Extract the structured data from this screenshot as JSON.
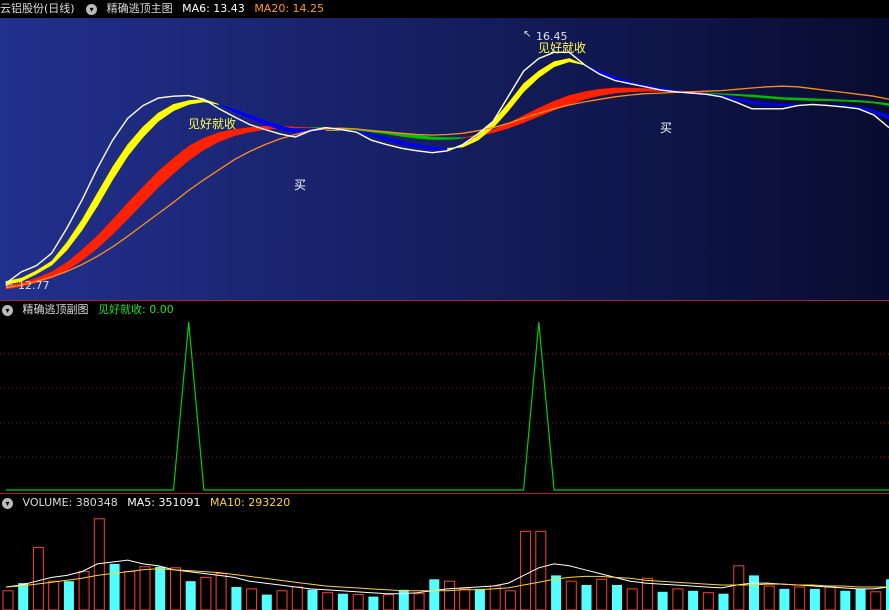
{
  "main": {
    "stock_name": "云铝股份(日线)",
    "indicator_name": "精确逃顶主图",
    "ma6_label": "MA6: 13.43",
    "ma20_label": "MA20: 14.25",
    "annotations": {
      "high_label": "16.45",
      "low_label": "12.77",
      "sell_1": "见好就收",
      "sell_2": "见好就收",
      "buy_1": "买",
      "buy_2": "买"
    },
    "colors": {
      "bg_top": "#1e2a86",
      "bg_bottom": "#0a0f3a",
      "price": "#ffffff",
      "ma": "#ff8c1a",
      "fast_band_up": "#ffff00",
      "fast_band_down": "#0000ff",
      "slow_band_up": "#ff2200",
      "slow_band_down": "#00c000"
    }
  },
  "sub": {
    "indicator_name": "精确逃顶副图",
    "signal_label": "见好就收: 0.00",
    "color": "#00d000"
  },
  "volume": {
    "volume_label": "VOLUME: 380348",
    "ma5_label": "MA5: 351091",
    "ma10_label": "MA10: 293220"
  },
  "chart_data": [
    {
      "type": "line",
      "name": "main",
      "n": 59,
      "price_range": [
        12.6,
        16.9
      ],
      "series": [
        {
          "key": "price",
          "values": [
            12.77,
            12.95,
            13.05,
            13.25,
            13.65,
            14.1,
            14.6,
            15.05,
            15.4,
            15.6,
            15.72,
            15.75,
            15.76,
            15.7,
            15.55,
            15.42,
            15.3,
            15.22,
            15.15,
            15.1,
            15.2,
            15.25,
            15.22,
            15.18,
            15.05,
            14.98,
            14.92,
            14.88,
            14.85,
            14.88,
            14.98,
            15.15,
            15.35,
            15.75,
            16.15,
            16.35,
            16.45,
            16.45,
            16.25,
            16.1,
            16.0,
            15.95,
            15.9,
            15.85,
            15.82,
            15.8,
            15.78,
            15.74,
            15.65,
            15.55,
            15.55,
            15.55,
            15.6,
            15.62,
            15.6,
            15.58,
            15.55,
            15.45,
            15.25
          ]
        },
        {
          "key": "fast",
          "values": [
            12.8,
            12.85,
            12.97,
            13.12,
            13.42,
            13.78,
            14.2,
            14.62,
            14.98,
            15.26,
            15.48,
            15.62,
            15.68,
            15.7,
            15.62,
            15.5,
            15.4,
            15.3,
            15.22,
            15.17,
            15.18,
            15.2,
            15.21,
            15.19,
            15.12,
            15.05,
            14.98,
            14.94,
            14.9,
            14.9,
            14.96,
            15.12,
            15.35,
            15.64,
            15.95,
            16.15,
            16.3,
            16.35,
            16.25,
            16.12,
            16.02,
            15.95,
            15.9,
            15.85,
            15.82,
            15.79,
            15.77,
            15.74,
            15.69,
            15.63,
            15.61,
            15.6,
            15.6,
            15.61,
            15.61,
            15.59,
            15.56,
            15.49,
            15.38
          ]
        },
        {
          "key": "fast2",
          "values": [
            12.75,
            12.8,
            12.92,
            13.06,
            13.3,
            13.62,
            14.0,
            14.42,
            14.8,
            15.1,
            15.35,
            15.52,
            15.62,
            15.66,
            15.62,
            15.54,
            15.45,
            15.36,
            15.28,
            15.22,
            15.2,
            15.2,
            15.21,
            15.2,
            15.15,
            15.09,
            15.03,
            14.98,
            14.94,
            14.92,
            14.94,
            15.05,
            15.25,
            15.52,
            15.82,
            16.05,
            16.22,
            16.3,
            16.25,
            16.15,
            16.06,
            15.98,
            15.93,
            15.88,
            15.84,
            15.81,
            15.79,
            15.76,
            15.72,
            15.67,
            15.64,
            15.62,
            15.61,
            15.61,
            15.61,
            15.6,
            15.58,
            15.53,
            15.44
          ]
        },
        {
          "key": "slow",
          "values": [
            12.72,
            12.78,
            12.85,
            12.95,
            13.1,
            13.3,
            13.52,
            13.78,
            14.05,
            14.3,
            14.55,
            14.76,
            14.95,
            15.08,
            15.17,
            15.22,
            15.25,
            15.27,
            15.27,
            15.26,
            15.25,
            15.24,
            15.23,
            15.21,
            15.18,
            15.15,
            15.11,
            15.08,
            15.06,
            15.06,
            15.08,
            15.14,
            15.22,
            15.32,
            15.44,
            15.56,
            15.67,
            15.76,
            15.82,
            15.86,
            15.88,
            15.88,
            15.87,
            15.86,
            15.84,
            15.82,
            15.8,
            15.78,
            15.76,
            15.74,
            15.72,
            15.7,
            15.69,
            15.68,
            15.68,
            15.67,
            15.66,
            15.64,
            15.6
          ]
        },
        {
          "key": "slow2",
          "values": [
            12.68,
            12.72,
            12.78,
            12.86,
            12.98,
            13.14,
            13.33,
            13.55,
            13.8,
            14.05,
            14.3,
            14.52,
            14.73,
            14.9,
            15.03,
            15.12,
            15.18,
            15.22,
            15.24,
            15.25,
            15.25,
            15.25,
            15.24,
            15.23,
            15.21,
            15.19,
            15.16,
            15.13,
            15.1,
            15.09,
            15.09,
            15.12,
            15.17,
            15.24,
            15.33,
            15.43,
            15.53,
            15.62,
            15.7,
            15.76,
            15.8,
            15.82,
            15.83,
            15.83,
            15.82,
            15.81,
            15.8,
            15.79,
            15.78,
            15.77,
            15.75,
            15.73,
            15.72,
            15.71,
            15.7,
            15.69,
            15.68,
            15.66,
            15.63
          ]
        },
        {
          "key": "ma",
          "values": [
            12.7,
            12.74,
            12.8,
            12.87,
            12.96,
            13.07,
            13.2,
            13.35,
            13.52,
            13.7,
            13.88,
            14.06,
            14.25,
            14.42,
            14.58,
            14.74,
            14.87,
            14.98,
            15.07,
            15.14,
            15.2,
            15.23,
            15.24,
            15.23,
            15.2,
            15.18,
            15.16,
            15.14,
            15.13,
            15.14,
            15.16,
            15.2,
            15.25,
            15.32,
            15.4,
            15.48,
            15.55,
            15.61,
            15.66,
            15.7,
            15.74,
            15.77,
            15.79,
            15.8,
            15.81,
            15.82,
            15.83,
            15.84,
            15.86,
            15.88,
            15.9,
            15.91,
            15.9,
            15.87,
            15.84,
            15.81,
            15.78,
            15.75,
            15.7
          ]
        }
      ]
    },
    {
      "type": "line",
      "name": "signal",
      "values": [
        0,
        0,
        0,
        0,
        0,
        0,
        0,
        0,
        0,
        0,
        0,
        0,
        1,
        0,
        0,
        0,
        0,
        0,
        0,
        0,
        0,
        0,
        0,
        0,
        0,
        0,
        0,
        0,
        0,
        0,
        0,
        0,
        0,
        0,
        0,
        1,
        0,
        0,
        0,
        0,
        0,
        0,
        0,
        0,
        0,
        0,
        0,
        0,
        0,
        0,
        0,
        0,
        0,
        0,
        0,
        0,
        0,
        0,
        0
      ],
      "ylim": [
        0,
        1
      ]
    },
    {
      "type": "bar",
      "name": "volume",
      "values": [
        20,
        28,
        65,
        30,
        30,
        40,
        95,
        48,
        40,
        45,
        45,
        44,
        30,
        34,
        38,
        24,
        22,
        16,
        20,
        24,
        21,
        18,
        17,
        16,
        14,
        16,
        21,
        17,
        32,
        30,
        22,
        22,
        25,
        20,
        82,
        82,
        36,
        30,
        26,
        32,
        26,
        22,
        33,
        19,
        22,
        20,
        18,
        17,
        46,
        36,
        25,
        22,
        24,
        22,
        24,
        20,
        22,
        19,
        32
      ],
      "up": [
        1,
        0,
        1,
        1,
        0,
        1,
        1,
        0,
        1,
        1,
        0,
        1,
        0,
        1,
        1,
        0,
        1,
        0,
        1,
        1,
        0,
        1,
        0,
        1,
        0,
        1,
        0,
        1,
        0,
        1,
        1,
        0,
        1,
        1,
        1,
        1,
        0,
        1,
        0,
        1,
        0,
        1,
        1,
        0,
        1,
        0,
        1,
        0,
        1,
        0,
        1,
        0,
        1,
        0,
        1,
        0,
        0,
        1,
        0
      ],
      "ma5": [
        24,
        26,
        30,
        34,
        36,
        40,
        48,
        50,
        52,
        48,
        46,
        42,
        40,
        38,
        36,
        34,
        30,
        28,
        26,
        24,
        22,
        21,
        20,
        19,
        18,
        17,
        17,
        18,
        20,
        22,
        23,
        24,
        25,
        28,
        36,
        44,
        48,
        46,
        42,
        38,
        34,
        30,
        28,
        27,
        26,
        25,
        24,
        23,
        26,
        28,
        28,
        27,
        26,
        25,
        24,
        23,
        22,
        22,
        24
      ],
      "ma10": [
        24,
        25,
        27,
        29,
        31,
        33,
        36,
        38,
        40,
        42,
        43,
        42,
        41,
        40,
        39,
        37,
        35,
        33,
        31,
        29,
        27,
        25,
        24,
        23,
        22,
        21,
        20,
        20,
        20,
        20,
        21,
        21,
        22,
        23,
        26,
        29,
        32,
        34,
        35,
        35,
        34,
        33,
        31,
        30,
        29,
        28,
        27,
        26,
        26,
        26,
        27,
        27,
        26,
        26,
        25,
        25,
        24,
        24,
        24
      ],
      "ylim": [
        0,
        100
      ]
    }
  ]
}
